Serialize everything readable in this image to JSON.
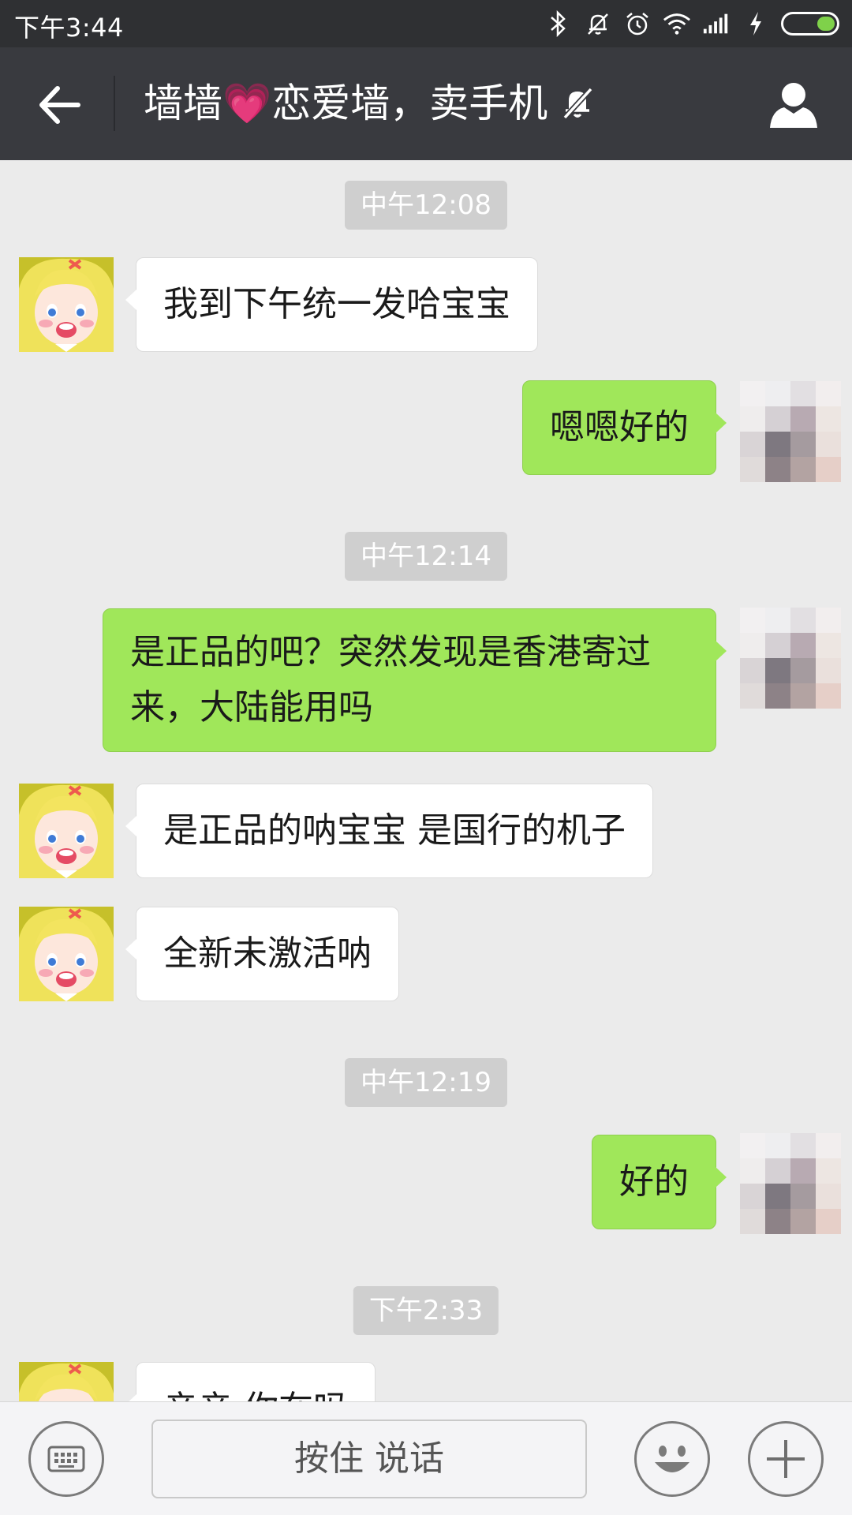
{
  "status_bar": {
    "time": "下午3:44"
  },
  "header": {
    "title": "墙墙💗恋爱墙，卖手机"
  },
  "chat": {
    "messages": [
      {
        "type": "timestamp",
        "text": "中午12:08"
      },
      {
        "type": "in",
        "text": "我到下午统一发哈宝宝"
      },
      {
        "type": "out",
        "text": "嗯嗯好的"
      },
      {
        "type": "timestamp",
        "text": "中午12:14"
      },
      {
        "type": "out",
        "text": "是正品的吧？突然发现是香港寄过来，大陆能用吗"
      },
      {
        "type": "in",
        "text": "是正品的呐宝宝 是国行的机子"
      },
      {
        "type": "in",
        "text": "全新未激活呐"
      },
      {
        "type": "timestamp",
        "text": "中午12:19"
      },
      {
        "type": "out",
        "text": "好的"
      },
      {
        "type": "timestamp",
        "text": "下午2:33"
      },
      {
        "type": "in",
        "text": "亲亲 你在吗"
      }
    ]
  },
  "input_bar": {
    "hold_to_talk_label": "按住 说话"
  },
  "icons": {
    "back": "arrow-left-icon",
    "mute": "bell-off-icon",
    "profile": "person-icon",
    "keyboard": "keyboard-icon",
    "emoji": "smiley-icon",
    "more": "plus-icon"
  },
  "colors": {
    "out_bubble": "#a0e75a",
    "in_bubble": "#ffffff",
    "header_bg": "#393a3f",
    "chat_bg": "#ebebeb"
  }
}
